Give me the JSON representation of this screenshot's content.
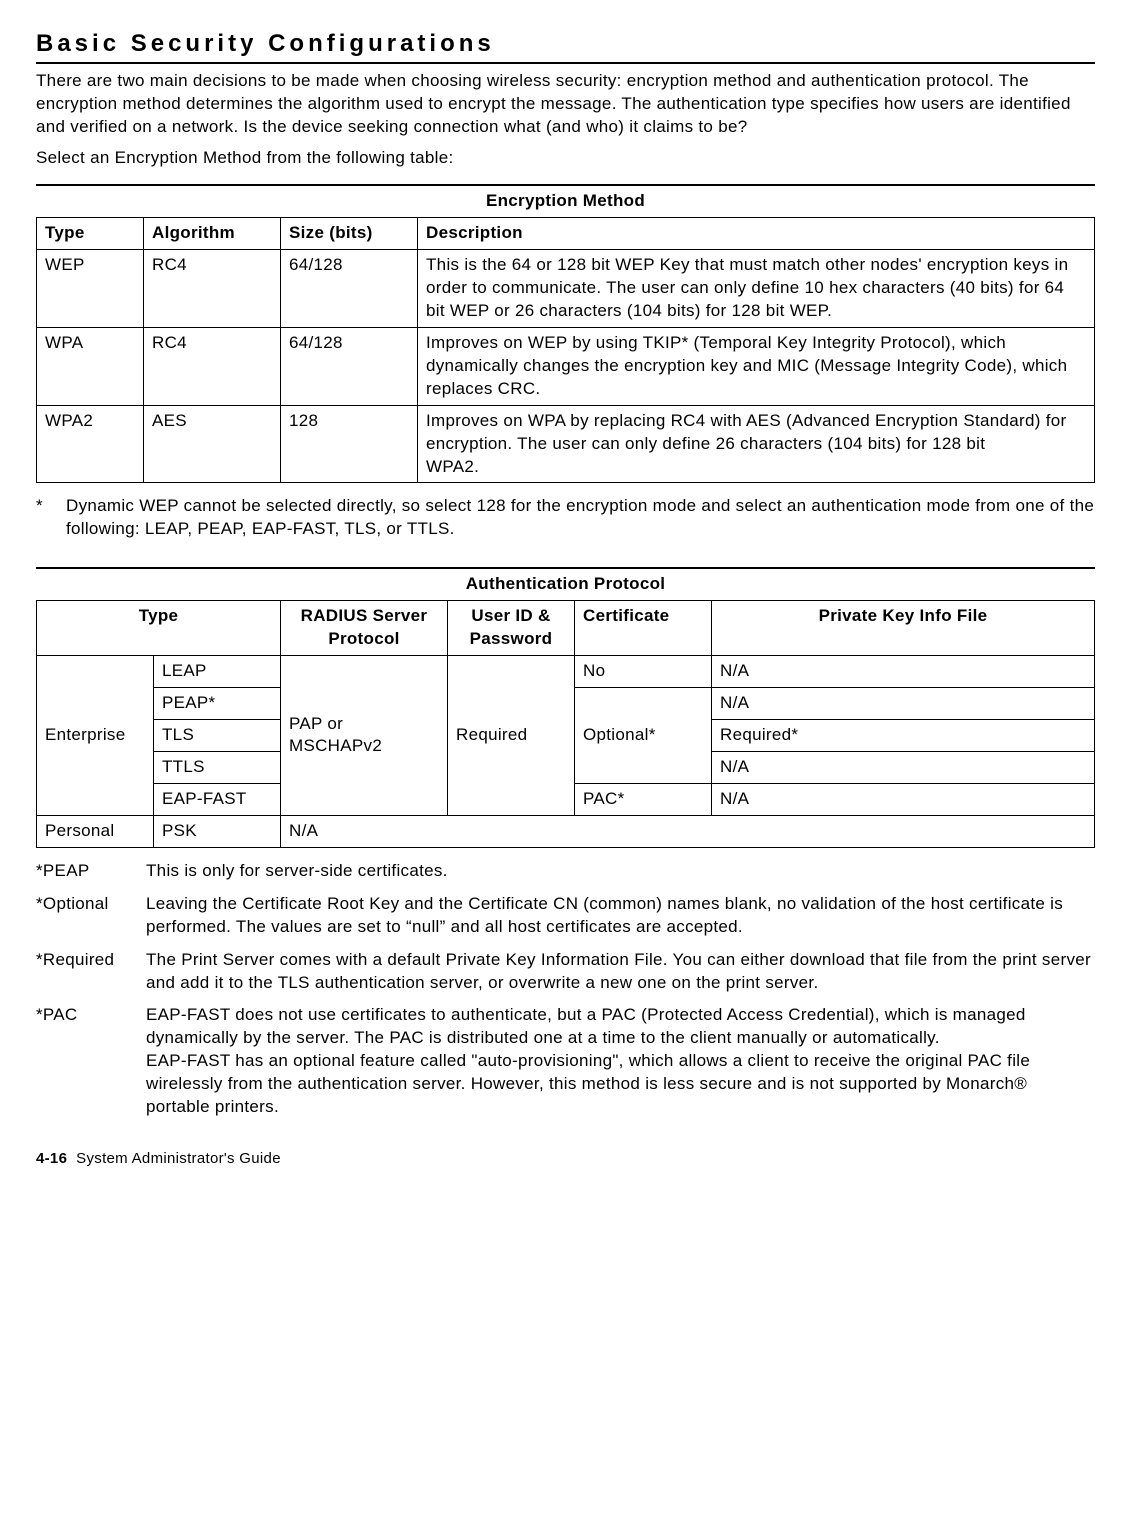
{
  "heading": "Basic Security Configurations",
  "intro1": "There are two main decisions to be made when choosing wireless security:  encryption method and authentication protocol.  The encryption method determines the algorithm used to encrypt the message.  The authentication type specifies how users are identified and verified on a network.  Is the device seeking connection what (and who) it claims to be?",
  "intro2": "Select an Encryption Method from the following table:",
  "encTable": {
    "caption": "Encryption Method",
    "headers": {
      "type": "Type",
      "alg": "Algorithm",
      "size": "Size (bits)",
      "desc": "Description"
    },
    "rows": [
      {
        "type": "WEP",
        "alg": "RC4",
        "size": "64/128",
        "desc": "This is the 64 or 128 bit WEP Key that must match other nodes' encryption keys in order to communicate.  The user can only define 10 hex characters (40 bits) for 64 bit WEP or 26 characters (104 bits) for 128 bit WEP."
      },
      {
        "type": "WPA",
        "alg": "RC4",
        "size": "64/128",
        "desc": "Improves on WEP by using TKIP* (Temporal Key Integrity Protocol), which dynamically changes the encryption key and MIC (Message Integrity Code), which replaces CRC."
      },
      {
        "type": "WPA2",
        "alg": "AES",
        "size": "128",
        "desc": "Improves on WPA by replacing RC4 with AES (Advanced Encryption Standard) for encryption.  The user can only define 26 characters (104 bits) for 128 bit\nWPA2."
      }
    ]
  },
  "starNote": {
    "mark": "*",
    "text": "Dynamic WEP cannot be selected directly, so select 128 for the encryption mode and select an authentication mode from one of the following:  LEAP, PEAP, EAP-FAST, TLS, or TTLS."
  },
  "authTable": {
    "caption": "Authentication Protocol",
    "headers": {
      "type": "Type",
      "radius": "RADIUS Server Protocol",
      "userid": "User ID & Password",
      "cert": "Certificate",
      "priv": "Private Key Info File"
    },
    "enterprise": "Enterprise",
    "entRows": {
      "leap": {
        "name": "LEAP",
        "cert": "No",
        "priv": "N/A"
      },
      "peap": {
        "name": "PEAP*",
        "priv": "N/A"
      },
      "tls": {
        "name": "TLS",
        "priv": "Required*"
      },
      "ttls": {
        "name": "TTLS",
        "priv": "N/A"
      },
      "eapfast": {
        "name": "EAP-FAST",
        "cert": "PAC*",
        "priv": "N/A"
      }
    },
    "radiusMerged": "PAP or MSCHAPv2",
    "useridMerged": "Required",
    "certMerged": "Optional*",
    "personal": {
      "label": "Personal",
      "name": "PSK",
      "na": "N/A"
    }
  },
  "notes": [
    {
      "label": "*PEAP",
      "desc": "This is only for server-side certificates."
    },
    {
      "label": "*Optional",
      "desc": "Leaving the Certificate Root Key and the Certificate CN (common) names blank, no validation of the host certificate is performed.  The values are set to “null” and all host certificates are accepted."
    },
    {
      "label": "*Required",
      "desc": "The Print Server comes with a default Private Key Information File.  You can either download that file from the print server and add it to the TLS authentication server, or overwrite a new one on the print server."
    },
    {
      "label": "*PAC",
      "desc": "EAP-FAST does not use certificates to authenticate, but a PAC (Protected Access Credential), which is managed dynamically by the server.  The PAC is distributed one at a time to the client manually or automatically.\nEAP-FAST has an optional feature called \"auto-provisioning\", which allows a client to receive the original PAC file wirelessly from the authentication server.  However, this method is less secure and is not supported by Monarch® portable printers."
    }
  ],
  "footer": {
    "page": "4-16",
    "title": "System Administrator's Guide"
  }
}
